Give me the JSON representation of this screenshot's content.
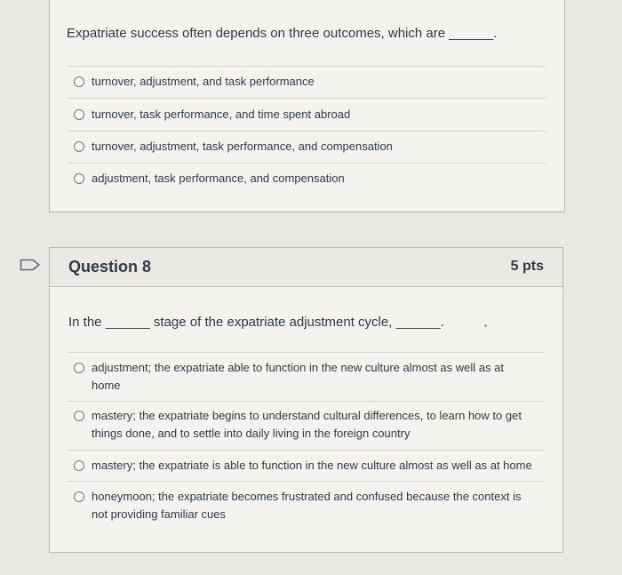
{
  "q7": {
    "question": "Expatriate success often depends on three outcomes, which are ______.",
    "answers": [
      "turnover, adjustment, and task performance",
      "turnover, task performance, and time spent abroad",
      "turnover, adjustment, task performance, and compensation",
      "adjustment, task performance, and compensation"
    ]
  },
  "q8": {
    "title": "Question 8",
    "points": "5 pts",
    "question": "In the ______ stage of the expatriate adjustment cycle, ______.",
    "answers": [
      "adjustment; the expatriate able to function in the new culture almost as well as at home",
      "mastery; the expatriate begins to understand cultural differences, to learn how to get things done, and to settle into daily living in the foreign country",
      "mastery; the expatriate is able to function in the new culture almost as well as at home",
      "honeymoon; the expatriate becomes frustrated and confused because the context is not providing familiar cues"
    ]
  },
  "icons": {
    "flag": "flag-outline-icon"
  },
  "colors": {
    "background": "#e9e8e5",
    "card": "#f4f3f0",
    "text": "#2d3b45"
  }
}
